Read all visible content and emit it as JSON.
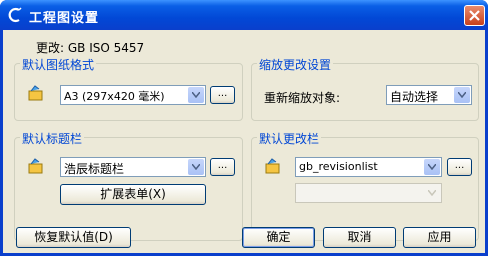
{
  "window": {
    "title": "工程图设置"
  },
  "change_line": "更改: GB ISO 5457",
  "default_sheet": {
    "group_label": "默认图纸格式",
    "value": "A3 (297x420 毫米)",
    "browse": "..."
  },
  "scale_change": {
    "group_label": "缩放更改设置",
    "label": "重新缩放对象:",
    "value": "自动选择"
  },
  "title_block": {
    "group_label": "默认标题栏",
    "value": "浩辰标题栏",
    "browse": "...",
    "expand_button": "扩展表单(X)"
  },
  "revision": {
    "group_label": "默认更改栏",
    "value": "gb_revisionlist",
    "browse": "...",
    "second_value": ""
  },
  "buttons": {
    "restore": "恢复默认值(D)",
    "ok": "确定",
    "cancel": "取消",
    "apply": "应用"
  }
}
